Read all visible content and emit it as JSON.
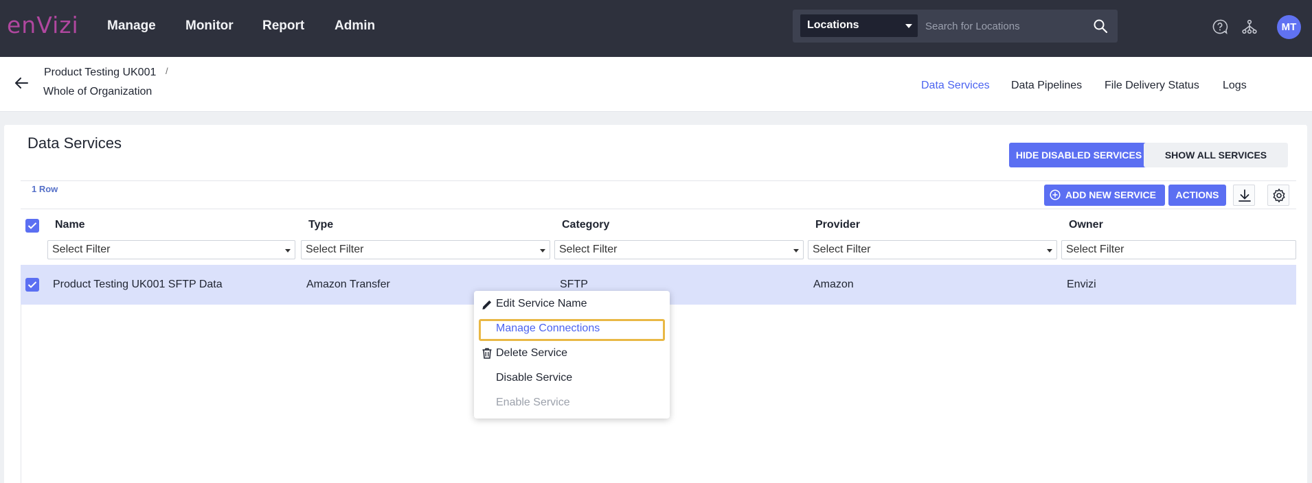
{
  "brand": {
    "logo_text": "enVizi",
    "accent": "#b0479f",
    "primary": "#5b6ff2"
  },
  "topnav": {
    "items": [
      {
        "label": "Manage"
      },
      {
        "label": "Monitor"
      },
      {
        "label": "Report"
      },
      {
        "label": "Admin"
      }
    ],
    "search": {
      "scope_selected": "Locations",
      "placeholder": "Search for Locations",
      "icon": "search-icon"
    },
    "help_icon": "help-icon",
    "hierarchy_icon": "hierarchy-icon",
    "avatar_initials": "MT"
  },
  "subheader": {
    "breadcrumb": {
      "item1": "Product Testing UK001",
      "separator": "/",
      "item2": "Whole of Organization"
    },
    "tabs": [
      {
        "label": "Data Services",
        "active": true
      },
      {
        "label": "Data Pipelines",
        "active": false
      },
      {
        "label": "File Delivery Status",
        "active": false
      },
      {
        "label": "Logs",
        "active": false
      }
    ]
  },
  "main": {
    "title": "Data Services",
    "hide_disabled_label": "HIDE DISABLED SERVICES",
    "show_all_label": "SHOW ALL SERVICES",
    "row_count": "1 Row",
    "add_new_label": "ADD NEW SERVICE",
    "actions_label": "ACTIONS",
    "table": {
      "columns": [
        "Name",
        "Type",
        "Category",
        "Provider",
        "Owner"
      ],
      "filter_placeholder": "Select Filter",
      "rows": [
        {
          "selected": true,
          "name": "Product Testing UK001 SFTP Data",
          "type": "Amazon Transfer",
          "category": "SFTP",
          "provider": "Amazon",
          "owner": "Envizi"
        }
      ]
    }
  },
  "context_menu": {
    "items": [
      {
        "label": "Edit Service Name",
        "icon": "pencil-icon",
        "state": "normal"
      },
      {
        "label": "Manage Connections",
        "icon": "",
        "state": "highlighted"
      },
      {
        "label": "Delete Service",
        "icon": "trash-icon",
        "state": "normal"
      },
      {
        "label": "Disable Service",
        "icon": "",
        "state": "normal"
      },
      {
        "label": "Enable Service",
        "icon": "",
        "state": "disabled"
      }
    ],
    "highlight_color": "#e9b845"
  }
}
